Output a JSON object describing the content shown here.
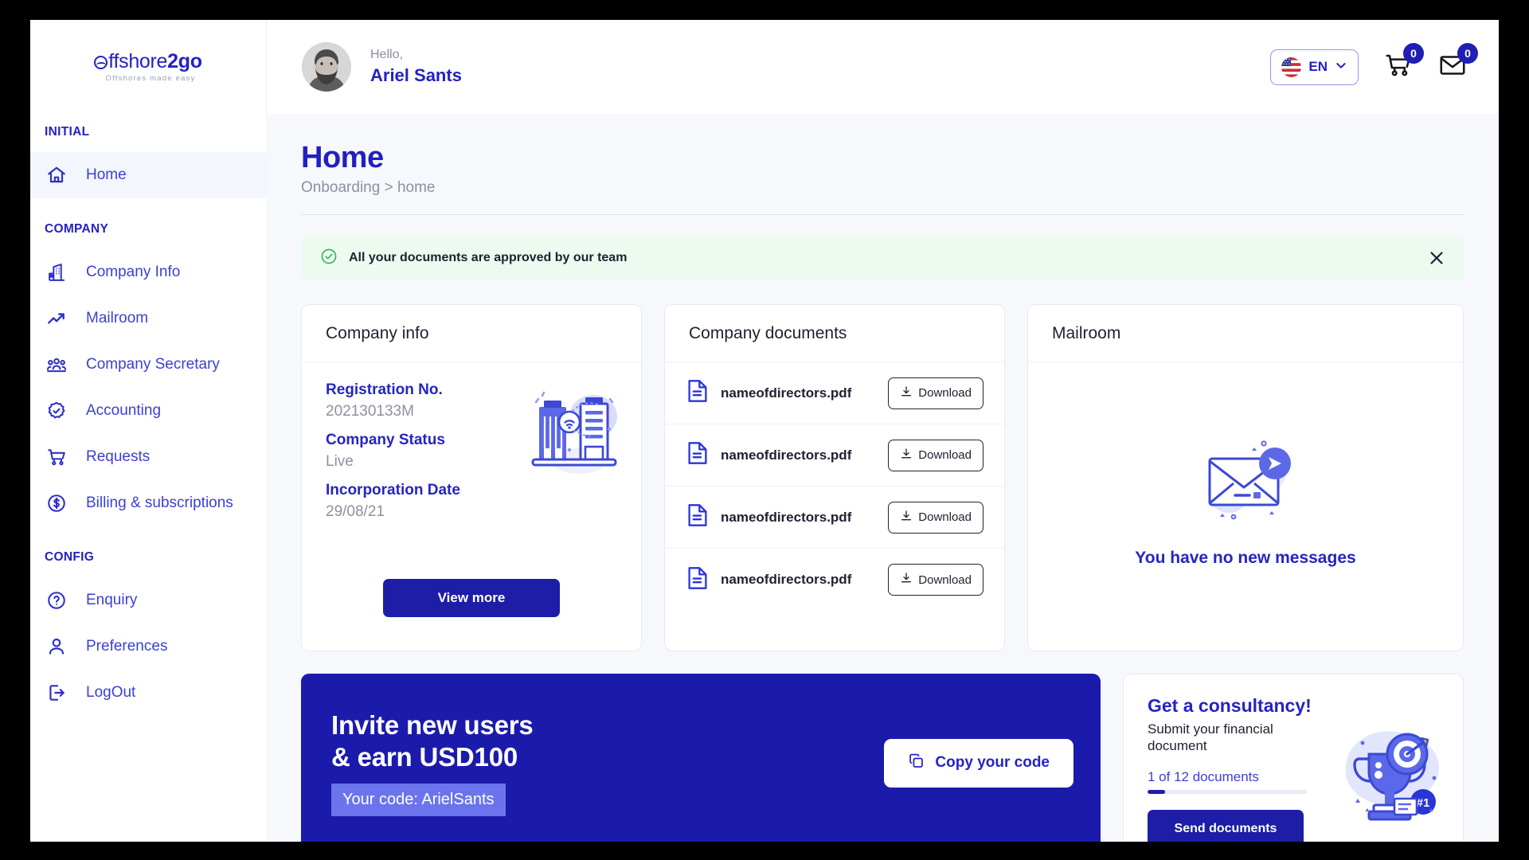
{
  "brand": {
    "name_light": "ffshore",
    "name_bold": "2go",
    "tagline": "Offshores made easy",
    "mark": "wave-circle-icon",
    "color": "#2222c4"
  },
  "sidebar": {
    "sections": [
      {
        "label": "INITIAL",
        "items": [
          {
            "label": "Home",
            "icon": "home-icon",
            "active": true
          }
        ]
      },
      {
        "label": "COMPANY",
        "items": [
          {
            "label": "Company Info",
            "icon": "buildings-icon",
            "active": false
          },
          {
            "label": "Mailroom",
            "icon": "trending-up-icon",
            "active": false
          },
          {
            "label": "Company Secretary",
            "icon": "users-group-icon",
            "active": false
          },
          {
            "label": "Accounting",
            "icon": "badge-check-icon",
            "active": false
          },
          {
            "label": "Requests",
            "icon": "shopping-cart-icon",
            "active": false
          },
          {
            "label": "Billing & subscriptions",
            "icon": "dollar-circle-icon",
            "active": false
          }
        ]
      },
      {
        "label": "CONFIG",
        "items": [
          {
            "label": "Enquiry",
            "icon": "question-circle-icon",
            "active": false
          },
          {
            "label": "Preferences",
            "icon": "user-icon",
            "active": false
          },
          {
            "label": "LogOut",
            "icon": "logout-icon",
            "active": false
          }
        ]
      }
    ]
  },
  "topbar": {
    "greeting": "Hello,",
    "user_name": "Ariel Sants",
    "avatar": "user-avatar",
    "language": {
      "code": "EN",
      "flag": "us-flag-icon",
      "chevron": "chevron-down-icon"
    },
    "cart": {
      "icon": "shopping-cart-icon",
      "badge": "0"
    },
    "mail": {
      "icon": "envelope-icon",
      "badge": "0"
    }
  },
  "page": {
    "title": "Home",
    "breadcrumb": "Onboarding > home"
  },
  "alert": {
    "icon": "check-circle-icon",
    "message": "All your documents are approved by our team",
    "close_icon": "close-icon"
  },
  "company_info": {
    "title": "Company info",
    "illustration": "buildings-network-illustration",
    "fields": [
      {
        "label": "Registration No.",
        "value": "202130133M"
      },
      {
        "label": "Company Status",
        "value": "Live"
      },
      {
        "label": "Incorporation Date",
        "value": "29/08/21"
      }
    ],
    "view_more_label": "View more"
  },
  "company_documents": {
    "title": "Company documents",
    "download_label": "Download",
    "download_icon": "download-icon",
    "file_icon": "file-document-icon",
    "rows": [
      {
        "name": "nameofdirectors.pdf"
      },
      {
        "name": "nameofdirectors.pdf"
      },
      {
        "name": "nameofdirectors.pdf"
      },
      {
        "name": "nameofdirectors.pdf"
      }
    ]
  },
  "mailroom": {
    "title": "Mailroom",
    "illustration": "envelope-send-illustration",
    "empty_message": "You have no new messages"
  },
  "invite": {
    "line1": "Invite new users",
    "line2": "& earn USD100",
    "code_label": "Your code: ArielSants",
    "copy_label": "Copy your code",
    "copy_icon": "copy-icon"
  },
  "consultancy": {
    "title": "Get a consultancy!",
    "subtitle": "Submit your financial document",
    "progress_label": "1 of 12 documents",
    "progress_percent": 11,
    "button_label": "Send documents",
    "illustration": "trophy-target-illustration"
  }
}
